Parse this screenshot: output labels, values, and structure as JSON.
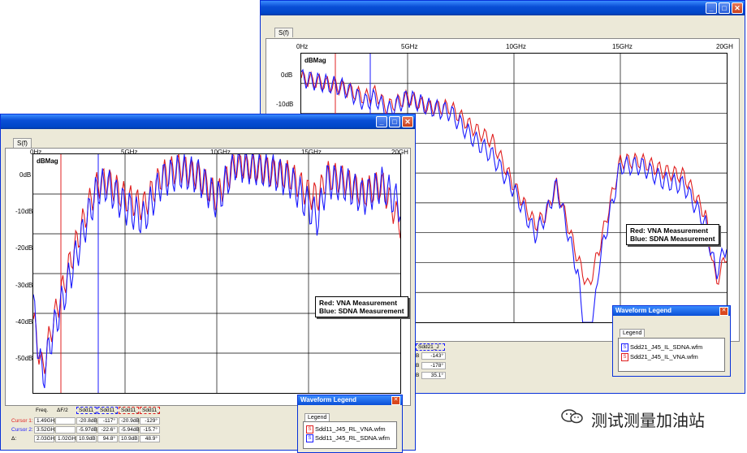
{
  "back": {
    "title": "",
    "tab_label": "S(f)",
    "plot_label": "dBMag",
    "x_ticks": [
      "0Hz",
      "5GHz",
      "10GHz",
      "15GHz",
      "20GH"
    ],
    "y_ticks": [
      "0dB",
      "-10dB"
    ],
    "annotation": {
      "line1": "Red: VNA Measurement",
      "line2": "Blue: SDNA Measurement"
    },
    "legend": {
      "title": "Waveform Legend",
      "tab": "Legend",
      "items": [
        {
          "icon": "S",
          "name": "Sdd21_J45_IL_SDNA.wfm",
          "color": "#1a1aff"
        },
        {
          "icon": "S",
          "name": "Sdd21_J45_IL_VNA.wfm",
          "color": "#e02020"
        }
      ]
    },
    "readout_header": "Sdd21_J",
    "readout": [
      [
        "B",
        "-143°"
      ],
      [
        "B",
        "-178°"
      ],
      [
        "B",
        "35.1°"
      ]
    ]
  },
  "front": {
    "title": "",
    "tab_label": "S(f)",
    "plot_label": "dBMag",
    "x_ticks": [
      "0Hz",
      "5GHz",
      "10GHz",
      "15GHz",
      "20GH"
    ],
    "y_ticks": [
      "0dB",
      "-10dB",
      "-20dB",
      "-30dB",
      "-40dB",
      "-50dB"
    ],
    "annotation": {
      "line1": "Red: VNA Measurement",
      "line2": "Blue: SDNA Measurement"
    },
    "legend": {
      "title": "Waveform Legend",
      "tab": "Legend",
      "items": [
        {
          "icon": "S",
          "name": "Sdd11_J45_RL_VNA.wfm",
          "color": "#e02020"
        },
        {
          "icon": "S",
          "name": "Sdd11_J45_RL_SDNA.wfm",
          "color": "#1a1aff"
        }
      ]
    },
    "readout": {
      "headers": [
        "Freq.",
        "ΔF/2",
        "Sdd11_J",
        "Sdd11_J",
        "Sdd11_J",
        "Sdd11_J"
      ],
      "rows": [
        {
          "label": "Cursor 1:",
          "color": "#e02020",
          "cells": [
            "1.49GHz",
            "",
            "-20.8dB",
            "-117°",
            "-20.9dB",
            "-129°"
          ]
        },
        {
          "label": "Cursor 2:",
          "color": "#1a1aff",
          "cells": [
            "3.52GHz",
            "",
            "-5.97dB",
            "-22.6°",
            "-5.94dB",
            "-15.7°"
          ]
        },
        {
          "label": "Δ:",
          "color": "#000000",
          "cells": [
            "2.03GHz",
            "1.02GHz",
            "10.9dB",
            "94.8°",
            "10.9dB",
            "48.9°"
          ]
        }
      ]
    }
  },
  "watermark": "测试测量加油站",
  "colors": {
    "vna": "#e02020",
    "sdna": "#1a1aff",
    "grid": "#000000"
  },
  "chart_data": [
    {
      "type": "line",
      "title": "",
      "xlabel": "",
      "ylabel": "dBMag",
      "xlim": [
        0,
        20
      ],
      "x_unit": "GHz",
      "ylim": [
        -50,
        5
      ],
      "series": [
        {
          "name": "VNA Measurement",
          "x": [
            0,
            1,
            2,
            3,
            3.5,
            4,
            5,
            6,
            7,
            8,
            9,
            10,
            11,
            11.5,
            12,
            13,
            13.5,
            14,
            15,
            16,
            17,
            18,
            19,
            19.5,
            20
          ],
          "y": [
            0,
            -1,
            -2,
            -4,
            -3,
            -6,
            -4,
            -6,
            -6,
            -10,
            -13,
            -22,
            -30,
            -28,
            -22,
            -37,
            -43,
            -35,
            -17,
            -17,
            -19,
            -20,
            -28,
            -42,
            -36
          ]
        },
        {
          "name": "SDNA Measurement",
          "x": [
            0,
            1,
            2,
            3,
            3.5,
            4,
            5,
            6,
            7,
            8,
            9,
            10,
            11,
            11.5,
            12,
            13,
            13.5,
            14,
            15,
            16,
            17,
            18,
            19,
            19.5,
            20
          ],
          "y": [
            0,
            -1,
            -2,
            -5,
            -4,
            -7,
            -4,
            -6,
            -7,
            -12,
            -16,
            -23,
            -32,
            -28,
            -22,
            -40,
            -60,
            -38,
            -18,
            -18,
            -21,
            -22,
            -30,
            -40,
            -34
          ]
        }
      ]
    },
    {
      "type": "line",
      "title": "",
      "xlabel": "",
      "ylabel": "dBMag",
      "xlim": [
        0,
        20
      ],
      "x_unit": "GHz",
      "ylim": [
        -55,
        0
      ],
      "series": [
        {
          "name": "VNA Measurement",
          "x": [
            0,
            0.5,
            1,
            2,
            3,
            3.5,
            4,
            5,
            6,
            7,
            8,
            9,
            10,
            11,
            12,
            13,
            14,
            15,
            15.5,
            16,
            17,
            18,
            19,
            20
          ],
          "y": [
            -38,
            -50,
            -40,
            -25,
            -12,
            -7,
            -6,
            -10,
            -12,
            -5,
            -3,
            -5,
            -10,
            -2,
            -3,
            -4,
            -5,
            -9,
            -10,
            -5,
            -6,
            -9,
            -7,
            -16
          ]
        },
        {
          "name": "SDNA Measurement",
          "x": [
            0,
            0.5,
            1,
            2,
            3,
            3.5,
            4,
            5,
            6,
            7,
            8,
            9,
            10,
            11,
            12,
            13,
            14,
            15,
            15.5,
            16,
            17,
            18,
            19,
            20
          ],
          "y": [
            -35,
            -52,
            -42,
            -28,
            -14,
            -8,
            -7,
            -12,
            -15,
            -6,
            -4,
            -5,
            -11,
            -2,
            -3,
            -4,
            -6,
            -12,
            -15,
            -6,
            -7,
            -10,
            -7,
            -12
          ]
        }
      ]
    }
  ]
}
